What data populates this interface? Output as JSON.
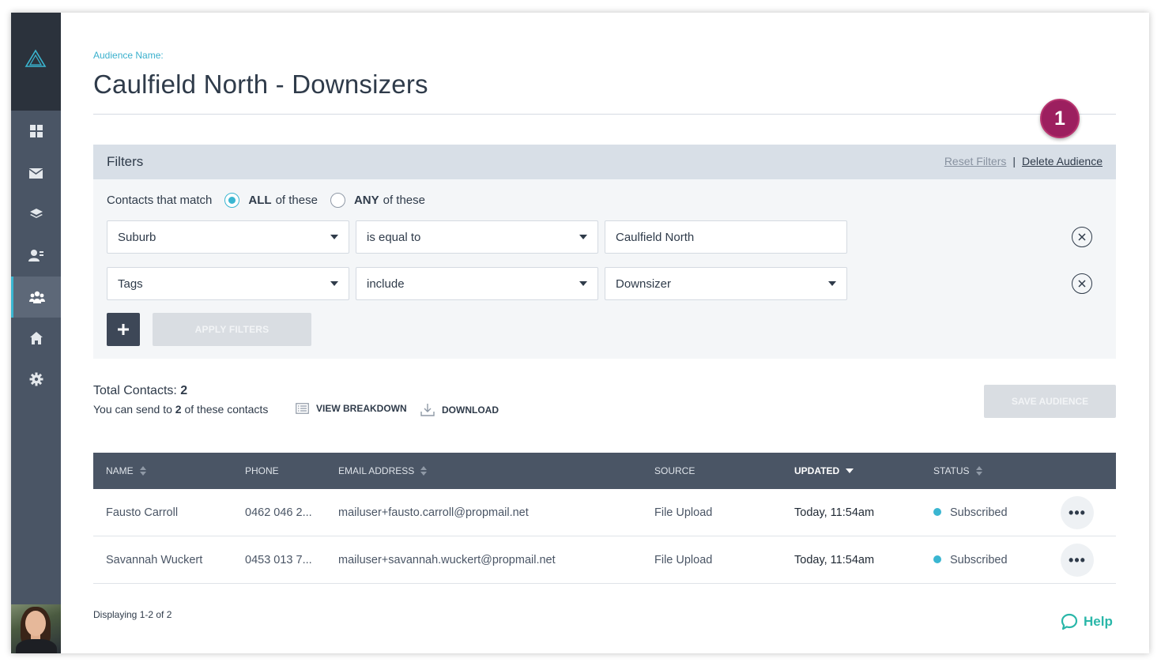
{
  "sidebar": {
    "logo": "triangle-logo-icon",
    "items": [
      {
        "name": "dashboard",
        "icon": "grid-icon"
      },
      {
        "name": "email",
        "icon": "envelope-icon"
      },
      {
        "name": "layers",
        "icon": "layers-icon"
      },
      {
        "name": "contacts",
        "icon": "contact-card-icon"
      },
      {
        "name": "audiences",
        "icon": "group-icon",
        "active": true
      },
      {
        "name": "properties",
        "icon": "home-icon"
      },
      {
        "name": "settings",
        "icon": "gear-icon"
      }
    ]
  },
  "header": {
    "label": "Audience Name:",
    "title": "Caulfield North - Downsizers",
    "badge": "1"
  },
  "filters": {
    "title": "Filters",
    "reset_label": "Reset Filters",
    "separator": "|",
    "delete_label": "Delete Audience",
    "match_label": "Contacts that match",
    "all_bold": "ALL",
    "all_rest": "of these",
    "any_bold": "ANY",
    "any_rest": "of these",
    "selected_match": "ALL",
    "rows": [
      {
        "field": "Suburb",
        "operator": "is equal to",
        "value": "Caulfield North",
        "value_is_select": false
      },
      {
        "field": "Tags",
        "operator": "include",
        "value": "Downsizer",
        "value_is_select": true
      }
    ],
    "add_label": "+",
    "apply_label": "APPLY FILTERS"
  },
  "summary": {
    "total_label": "Total Contacts:",
    "total_value": "2",
    "send_prefix": "You can send to",
    "send_count": "2",
    "send_suffix": "of these contacts",
    "breakdown_label": "VIEW BREAKDOWN",
    "download_label": "DOWNLOAD",
    "save_label": "SAVE AUDIENCE"
  },
  "table": {
    "columns": {
      "name": "NAME",
      "phone": "PHONE",
      "email": "EMAIL ADDRESS",
      "source": "SOURCE",
      "updated": "UPDATED",
      "status": "STATUS"
    },
    "sorted_by": "UPDATED",
    "rows": [
      {
        "name": "Fausto Carroll",
        "phone": "0462 046 2...",
        "email": "mailuser+fausto.carroll@propmail.net",
        "source": "File Upload",
        "updated": "Today, 11:54am",
        "status": "Subscribed",
        "more": "•••"
      },
      {
        "name": "Savannah Wuckert",
        "phone": "0453 013 7...",
        "email": "mailuser+savannah.wuckert@propmail.net",
        "source": "File Upload",
        "updated": "Today, 11:54am",
        "status": "Subscribed",
        "more": "•••"
      }
    ],
    "status_color": "#3ab6d1"
  },
  "footer": {
    "displaying": "Displaying 1-2 of 2",
    "help_label": "Help"
  },
  "colors": {
    "accent": "#3ab6d1",
    "sidebar": "#4a5565",
    "badge": "#9c1f5f",
    "help": "#2ab7a9"
  }
}
